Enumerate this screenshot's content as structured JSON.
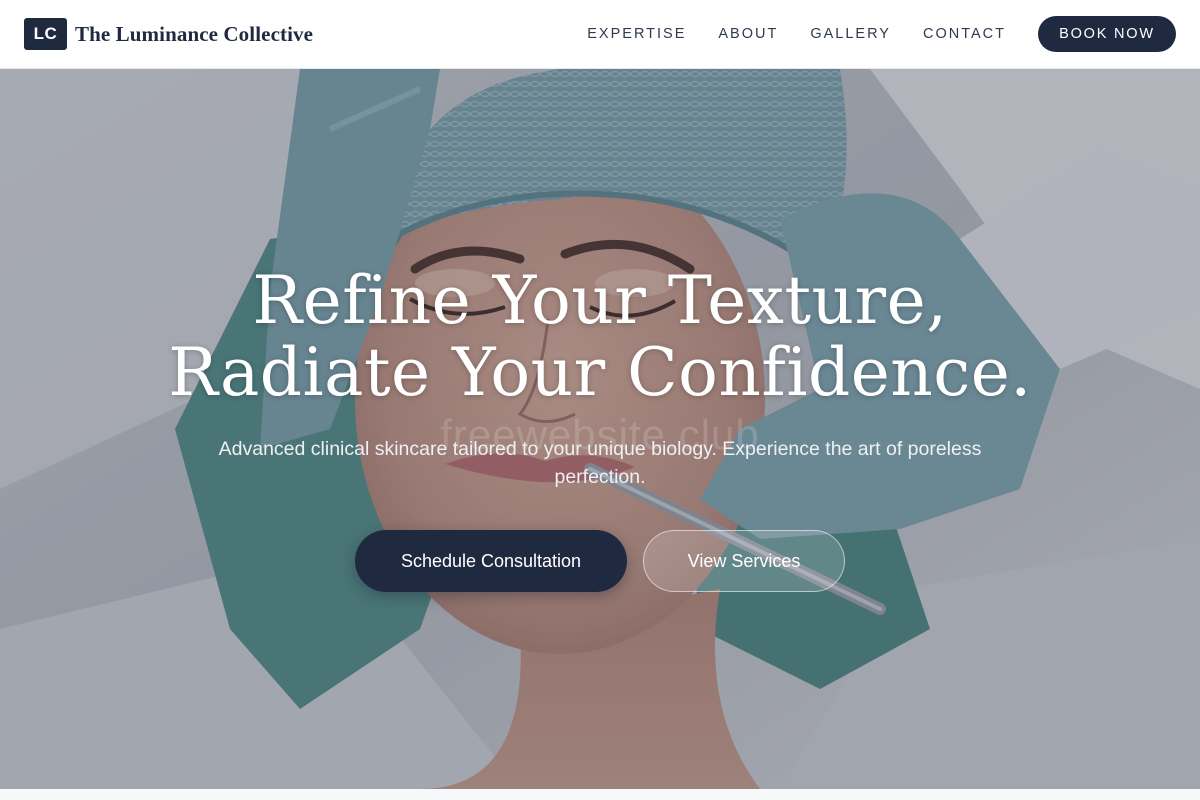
{
  "brand": {
    "logo_text": "LC",
    "name": "The Luminance Collective"
  },
  "nav": {
    "links": [
      "EXPERTISE",
      "ABOUT",
      "GALLERY",
      "CONTACT"
    ],
    "cta_label": "BOOK NOW"
  },
  "hero": {
    "title_line1": "Refine Your Texture,",
    "title_line2": "Radiate Your Confidence.",
    "subtitle": "Advanced clinical skincare tailored to your unique biology. Experience the art of poreless perfection.",
    "primary_button": "Schedule Consultation",
    "secondary_button": "View Services",
    "watermark": "freewebsite.club",
    "image_description": "Woman in surgical cap receiving facial skin treatment from gloved practitioner"
  },
  "colors": {
    "brand_navy": "#1f2a40",
    "glove_teal": "#7aa3ad",
    "cap_teal": "#6f97a2",
    "towel_teal": "#4f8b87"
  }
}
